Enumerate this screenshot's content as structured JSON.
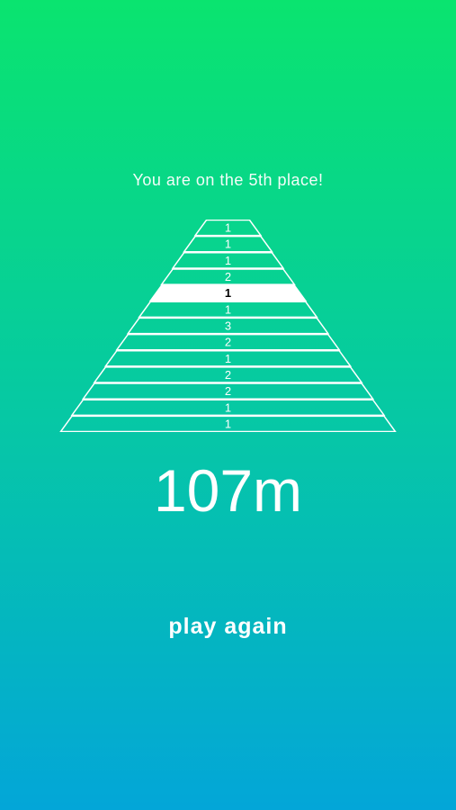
{
  "result": {
    "place_text": "You are on the 5th place!",
    "distance": "107m",
    "play_again_label": "play again"
  },
  "leaderboard": {
    "highlighted_rank": 5,
    "rows": [
      {
        "rank": 1,
        "value": "1"
      },
      {
        "rank": 2,
        "value": "1"
      },
      {
        "rank": 3,
        "value": "1"
      },
      {
        "rank": 4,
        "value": "2"
      },
      {
        "rank": 5,
        "value": "1"
      },
      {
        "rank": 6,
        "value": "1"
      },
      {
        "rank": 7,
        "value": "3"
      },
      {
        "rank": 8,
        "value": "2"
      },
      {
        "rank": 9,
        "value": "1"
      },
      {
        "rank": 10,
        "value": "2"
      },
      {
        "rank": 11,
        "value": "2"
      },
      {
        "rank": 12,
        "value": "1"
      },
      {
        "rank": 13,
        "value": "1"
      }
    ]
  },
  "colors": {
    "gradient_top": "#0ae46f",
    "gradient_bottom": "#03a6d8",
    "line": "#ffffff",
    "highlight_fill": "#ffffff",
    "highlight_text": "#000000"
  }
}
